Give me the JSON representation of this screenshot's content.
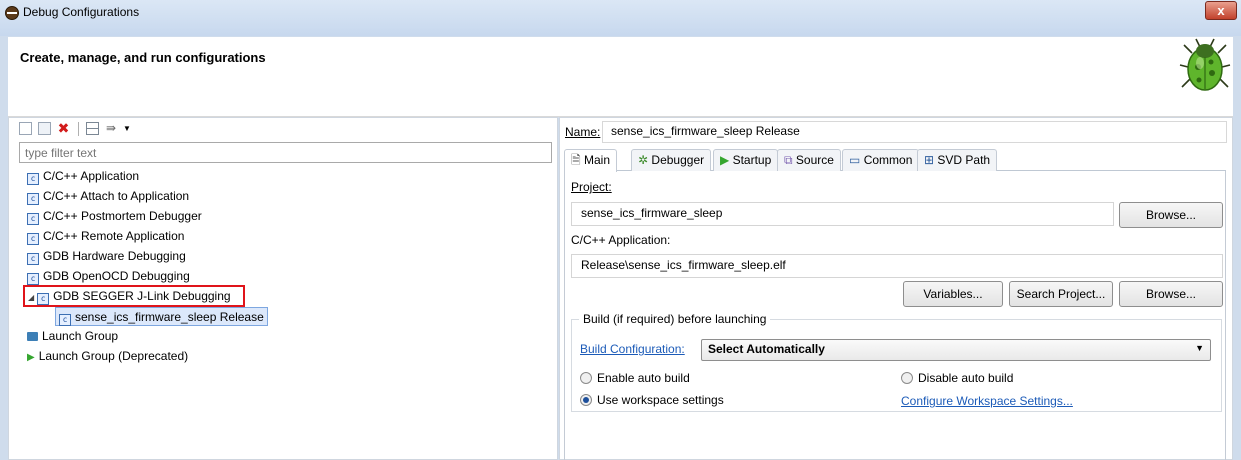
{
  "window": {
    "title": "Debug Configurations",
    "close_label": "x"
  },
  "header": {
    "title": "Create, manage, and run configurations"
  },
  "filter": {
    "placeholder": "type filter text"
  },
  "tree": {
    "items": [
      {
        "label": "C/C++ Application",
        "icon": "c-config-icon"
      },
      {
        "label": "C/C++ Attach to Application",
        "icon": "c-config-icon"
      },
      {
        "label": "C/C++ Postmortem Debugger",
        "icon": "c-config-icon"
      },
      {
        "label": "C/C++ Remote Application",
        "icon": "c-config-icon"
      },
      {
        "label": "GDB Hardware Debugging",
        "icon": "c-config-icon"
      },
      {
        "label": "GDB OpenOCD Debugging",
        "icon": "c-config-icon"
      },
      {
        "label": "GDB SEGGER J-Link Debugging",
        "icon": "c-config-icon",
        "expanded": true
      },
      {
        "label": "sense_ics_firmware_sleep Release",
        "icon": "c-config-icon",
        "selected": true
      },
      {
        "label": "Launch Group",
        "icon": "launch-group-icon"
      },
      {
        "label": "Launch Group (Deprecated)",
        "icon": "play-icon"
      }
    ]
  },
  "config": {
    "name_label": "Name:",
    "name_value": "sense_ics_firmware_sleep Release",
    "tabs": [
      {
        "label": "Main",
        "icon": "document-icon"
      },
      {
        "label": "Debugger",
        "icon": "bug-icon"
      },
      {
        "label": "Startup",
        "icon": "play-icon"
      },
      {
        "label": "Source",
        "icon": "source-icon"
      },
      {
        "label": "Common",
        "icon": "common-icon"
      },
      {
        "label": "SVD Path",
        "icon": "svd-icon"
      }
    ],
    "project_label": "Project:",
    "project_value": "sense_ics_firmware_sleep",
    "browse_label": "Browse...",
    "app_label": "C/C++ Application:",
    "app_value": "Release\\sense_ics_firmware_sleep.elf",
    "variables_label": "Variables...",
    "search_project_label": "Search Project...",
    "build_group_title": "Build (if required) before launching",
    "build_config_link": "Build Configuration:",
    "build_config_value": "Select Automatically",
    "enable_auto_build": "Enable auto build",
    "disable_auto_build": "Disable auto build",
    "use_workspace": "Use workspace settings",
    "configure_workspace_link": "Configure Workspace Settings...",
    "selected_radio": "Use workspace settings"
  },
  "colors": {
    "highlight_box": "#e0141a",
    "link": "#1c5bb8",
    "selection": "#dce8fb"
  }
}
